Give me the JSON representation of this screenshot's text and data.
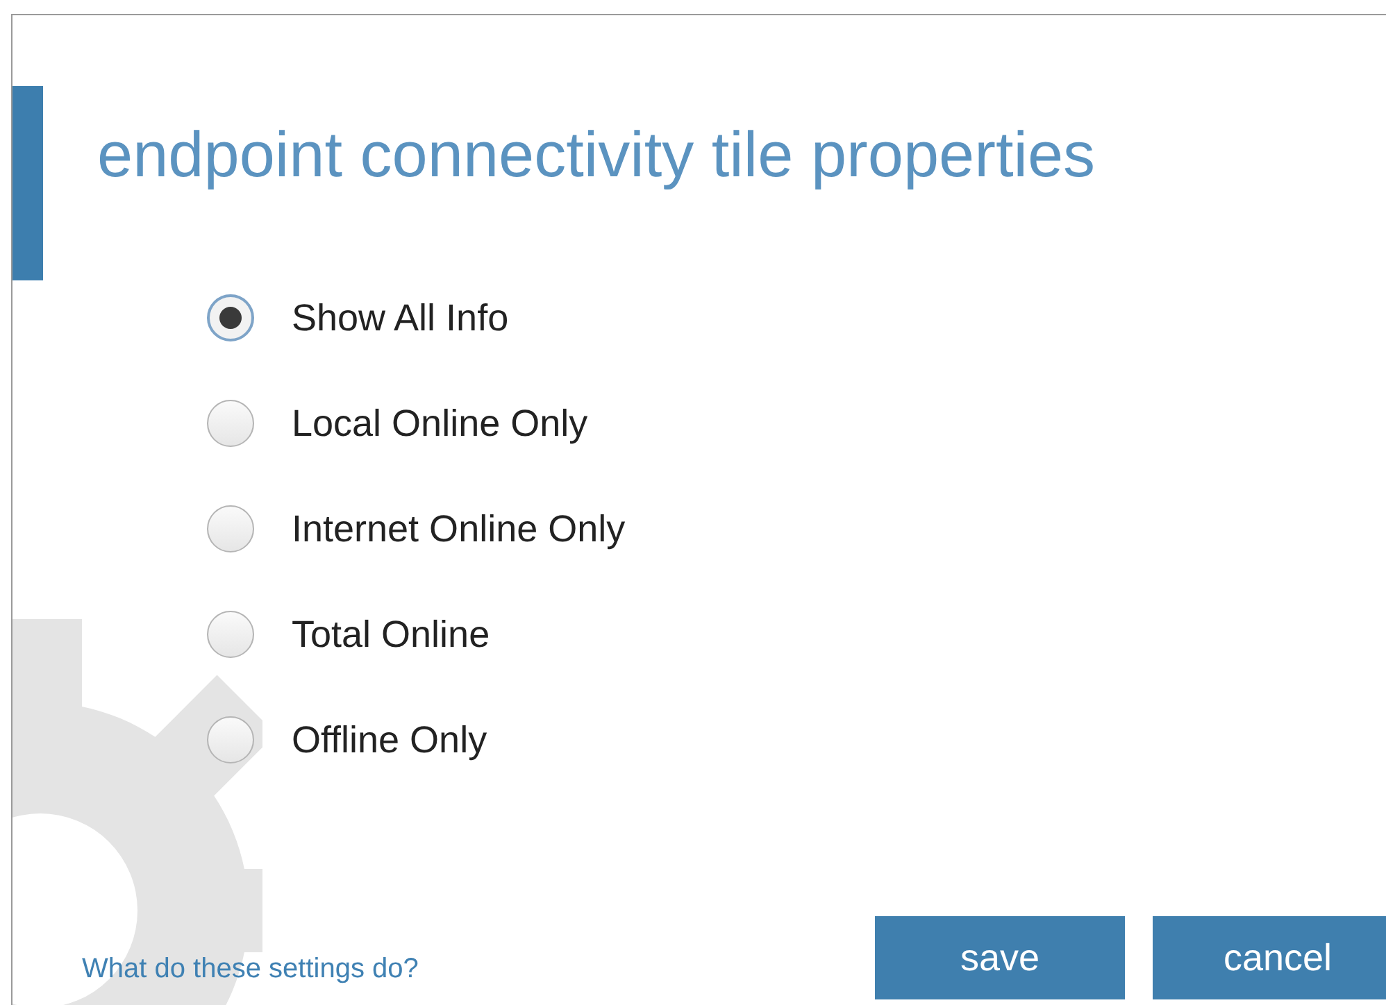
{
  "dialog": {
    "title": "endpoint connectivity tile properties"
  },
  "options": [
    {
      "label": "Show All Info",
      "selected": true
    },
    {
      "label": "Local Online Only",
      "selected": false
    },
    {
      "label": "Internet Online Only",
      "selected": false
    },
    {
      "label": "Total Online",
      "selected": false
    },
    {
      "label": "Offline Only",
      "selected": false
    }
  ],
  "help_link": "What do these settings do?",
  "buttons": [
    {
      "label": "save"
    },
    {
      "label": "cancel"
    }
  ]
}
